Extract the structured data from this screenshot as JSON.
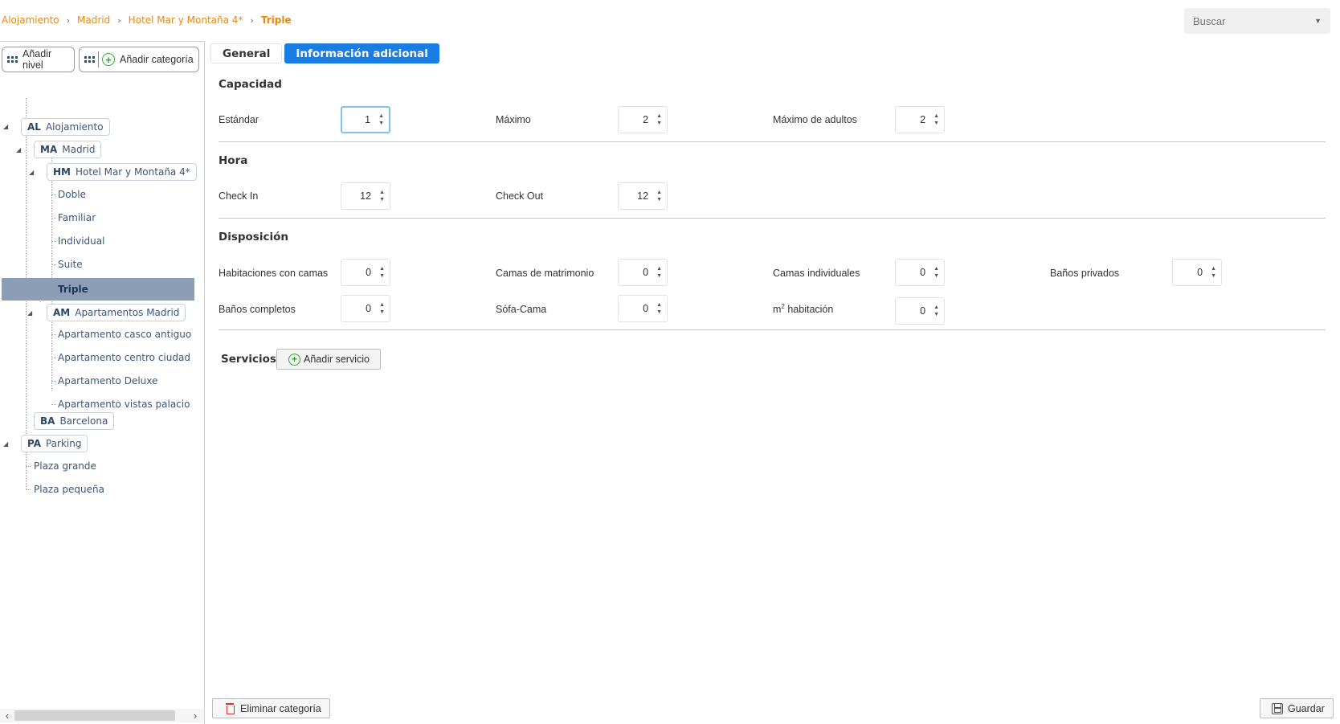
{
  "breadcrumb": {
    "items": [
      "Alojamiento",
      "Madrid",
      "Hotel Mar y Montaña 4*",
      "Triple"
    ]
  },
  "search": {
    "placeholder": "Buscar"
  },
  "toolbar": {
    "add_level": "Añadir nivel",
    "add_category": "Añadir categoría"
  },
  "tree": {
    "alojamiento": {
      "abbr": "AL",
      "label": "Alojamiento"
    },
    "madrid": {
      "abbr": "MA",
      "label": "Madrid"
    },
    "hotel": {
      "abbr": "HM",
      "label": "Hotel Mar y Montaña 4*"
    },
    "hotel_items": [
      "Doble",
      "Familiar",
      "Individual",
      "Suite",
      "Triple"
    ],
    "apartamentos": {
      "abbr": "AM",
      "label": "Apartamentos Madrid"
    },
    "apartamentos_items": [
      "Apartamento casco antiguo",
      "Apartamento centro ciudad",
      "Apartamento Deluxe",
      "Apartamento vistas palacio"
    ],
    "barcelona": {
      "abbr": "BA",
      "label": "Barcelona"
    },
    "parking": {
      "abbr": "PA",
      "label": "Parking"
    },
    "parking_items": [
      "Plaza grande",
      "Plaza pequeña"
    ],
    "selected": "Triple"
  },
  "tabs": {
    "general": "General",
    "info": "Información adicional"
  },
  "capacidad": {
    "title": "Capacidad",
    "estandar_label": "Estándar",
    "estandar_value": "1",
    "maximo_label": "Máximo",
    "maximo_value": "2",
    "adultos_label": "Máximo de adultos",
    "adultos_value": "2"
  },
  "hora": {
    "title": "Hora",
    "checkin_label": "Check In",
    "checkin_value": "12",
    "checkout_label": "Check Out",
    "checkout_value": "12"
  },
  "disposicion": {
    "title": "Disposición",
    "habitaciones_label": "Habitaciones con camas",
    "habitaciones_value": "0",
    "matrimonio_label": "Camas de matrimonio",
    "matrimonio_value": "0",
    "individuales_label": "Camas individuales",
    "individuales_value": "0",
    "privados_label": "Baños privados",
    "privados_value": "0",
    "completos_label": "Baños completos",
    "completos_value": "0",
    "sofa_label": "Sófa-Cama",
    "sofa_value": "0",
    "m2_unit": "m",
    "m2_sup": "2",
    "m2_label": " habitación",
    "m2_value": "0"
  },
  "servicios": {
    "title": "Servicios",
    "add_label": "Añadir servicio"
  },
  "footer": {
    "delete_label": "Eliminar categoría",
    "save_label": "Guardar"
  },
  "colors": {
    "accent": "#1a7de4",
    "breadcrumb": "#e8890c",
    "selected_row": "#8c9db6",
    "add_icon": "#35a735",
    "delete_icon": "#d9302c"
  }
}
